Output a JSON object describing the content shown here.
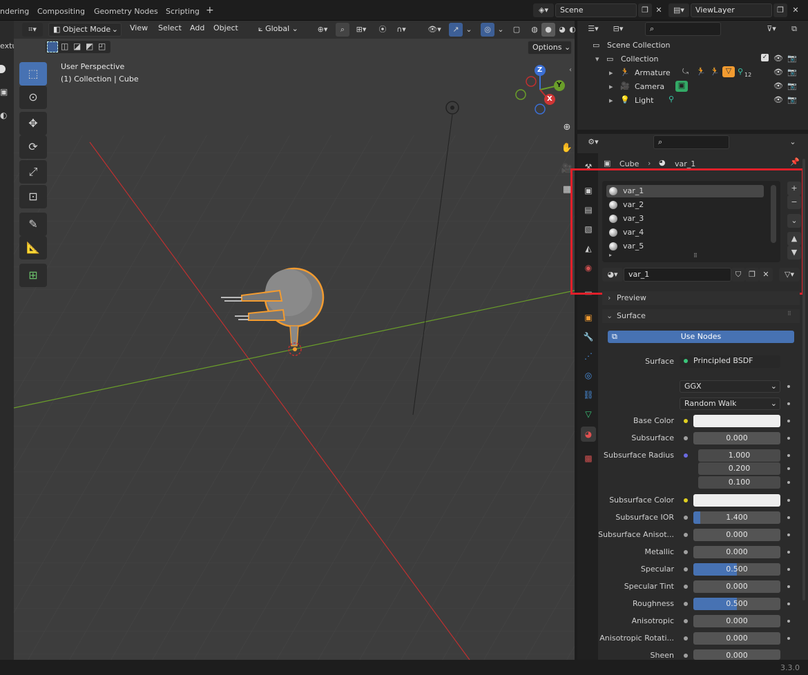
{
  "topbar": {
    "tabs": [
      "ndering",
      "Compositing",
      "Geometry Nodes",
      "Scripting"
    ],
    "add_tab": "+",
    "scene": "Scene",
    "view_layer": "ViewLayer"
  },
  "viewport_header": {
    "mode": "Object Mode",
    "menus": [
      "View",
      "Select",
      "Add",
      "Object"
    ],
    "transform_orientation": "Global",
    "options": "Options"
  },
  "left_stub_text": "extu",
  "viewport": {
    "view_name": "User Perspective",
    "collection_label": "(1) Collection | Cube",
    "axis_x": "X",
    "axis_y": "Y",
    "axis_z": "Z"
  },
  "outliner": {
    "scene_collection": "Scene Collection",
    "collection": "Collection",
    "items": [
      "Armature",
      "Camera",
      "Light"
    ],
    "armature_count": "12"
  },
  "properties": {
    "breadcrumb_object": "Cube",
    "breadcrumb_material": "var_1",
    "material_slots": [
      "var_1",
      "var_2",
      "var_3",
      "var_4",
      "var_5"
    ],
    "active_material": "var_1",
    "preview_label": "Preview",
    "surface_label": "Surface",
    "use_nodes": "Use Nodes",
    "surface_row_label": "Surface",
    "surface_shader": "Principled BSDF",
    "distribution": "GGX",
    "subsurface_method": "Random Walk",
    "fields": {
      "base_color": "Base Color",
      "subsurface": "Subsurface",
      "subsurface_value": "0.000",
      "subsurface_radius": "Subsurface Radius",
      "radius_1": "1.000",
      "radius_2": "0.200",
      "radius_3": "0.100",
      "subsurface_color": "Subsurface Color",
      "subsurface_ior": "Subsurface IOR",
      "subsurface_ior_value": "1.400",
      "subsurface_anisotropy": "Subsurface Anisot...",
      "subsurface_anisotropy_value": "0.000",
      "metallic": "Metallic",
      "metallic_value": "0.000",
      "specular": "Specular",
      "specular_value": "0.500",
      "specular_tint": "Specular Tint",
      "specular_tint_value": "0.000",
      "roughness": "Roughness",
      "roughness_value": "0.500",
      "anisotropic": "Anisotropic",
      "anisotropic_value": "0.000",
      "anisotropic_rotation": "Anisotropic Rotati...",
      "anisotropic_rotation_value": "0.000",
      "sheen": "Sheen",
      "sheen_value": "0.000"
    },
    "slider_fill": {
      "subsurface_ior": 0.08,
      "specular": 0.5,
      "roughness": 0.5
    }
  },
  "status": {
    "version": "3.3.0"
  },
  "colors": {
    "accent": "#4772b3",
    "highlight_box": "#e0202a",
    "selection_orange": "#f29b30",
    "axis_red": "#c03030",
    "axis_green": "#6a9e2a"
  }
}
